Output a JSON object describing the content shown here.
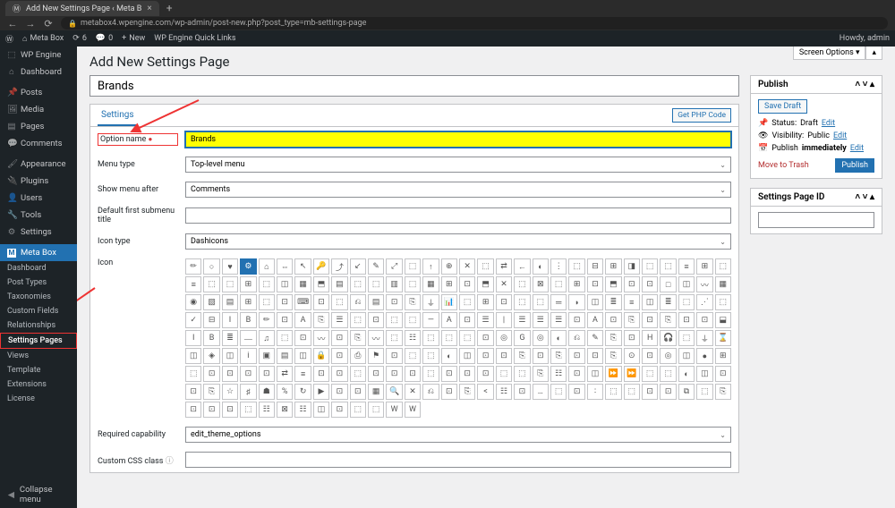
{
  "browser": {
    "tab_title": "Add New Settings Page ‹ Meta B",
    "url": "metabox4.wpengine.com/wp-admin/post-new.php?post_type=mb-settings-page"
  },
  "adminbar": {
    "site": "Meta Box",
    "updates": "6",
    "comments": "0",
    "new": "New",
    "quicklinks": "WP Engine Quick Links",
    "howdy": "Howdy, admin"
  },
  "menu": {
    "items": [
      {
        "label": "WP Engine",
        "icon": "⚙"
      },
      {
        "label": "Dashboard",
        "icon": "⌂"
      },
      {
        "label": "Posts",
        "icon": "📌"
      },
      {
        "label": "Media",
        "icon": "🖼"
      },
      {
        "label": "Pages",
        "icon": "▤"
      },
      {
        "label": "Comments",
        "icon": "💬"
      },
      {
        "label": "Appearance",
        "icon": "🖌"
      },
      {
        "label": "Plugins",
        "icon": "🔌"
      },
      {
        "label": "Users",
        "icon": "👤"
      },
      {
        "label": "Tools",
        "icon": "🔧"
      },
      {
        "label": "Settings",
        "icon": "⚙"
      }
    ],
    "metabox_label": "Meta Box",
    "submenu": [
      "Dashboard",
      "Post Types",
      "Taxonomies",
      "Custom Fields",
      "Relationships",
      "Settings Pages",
      "Views",
      "Template",
      "Extensions",
      "License"
    ],
    "collapse": "Collapse menu"
  },
  "page": {
    "heading": "Add New Settings Page",
    "title_value": "Brands",
    "screen_options": "Screen Options"
  },
  "settings": {
    "tab": "Settings",
    "get_php": "Get PHP Code",
    "fields": {
      "option_name": {
        "label": "Option name",
        "value": "Brands"
      },
      "menu_type": {
        "label": "Menu type",
        "value": "Top-level menu"
      },
      "show_menu_after": {
        "label": "Show menu after",
        "value": "Comments"
      },
      "default_submenu": {
        "label": "Default first submenu title",
        "value": ""
      },
      "icon_type": {
        "label": "Icon type",
        "value": "Dashicons"
      },
      "icon": {
        "label": "Icon"
      },
      "required_cap": {
        "label": "Required capability",
        "value": "edit_theme_options"
      },
      "css_class": {
        "label": "Custom CSS class",
        "value": ""
      }
    }
  },
  "publish": {
    "title": "Publish",
    "save_draft": "Save Draft",
    "status_label": "Status:",
    "status_value": "Draft",
    "edit": "Edit",
    "visibility_label": "Visibility:",
    "visibility_value": "Public",
    "publish_label": "Publish",
    "publish_value": "immediately",
    "trash": "Move to Trash",
    "publish_btn": "Publish"
  },
  "settings_id": {
    "title": "Settings Page ID"
  },
  "icon_glyphs": [
    "✏",
    "○",
    "♥",
    "⚙",
    "⌂",
    "⇔",
    "↖",
    "🔑",
    "⤴",
    "↙",
    "✎",
    "⤢",
    "⬚",
    "↑",
    "⊕",
    "✕",
    "⬚",
    "⇄",
    "←",
    "◐",
    "⋮",
    "⬚",
    "⊟",
    "⊞",
    "◨",
    "⬚",
    "⬚",
    "≡",
    "⊞",
    "⬚",
    "≡",
    "⬚",
    "⬚",
    "⊞",
    "⬚",
    "◫",
    "▦",
    "⬒",
    "▤",
    "⬚",
    "⬚",
    "▥",
    "⬚",
    "▦",
    "⊞",
    "⊡",
    "⬒",
    "✕",
    "⬚",
    "⊠",
    "⬚",
    "⊞",
    "⊡",
    "⬒",
    "⊡",
    "⊡",
    "□",
    "◫",
    "〰",
    "▦",
    "◉",
    "▧",
    "▤",
    "⊞",
    "⬚",
    "⊡",
    "⌨",
    "⊡",
    "⬚",
    "⎌",
    "▤",
    "⊡",
    "⎘",
    "⏚",
    "📊",
    "⬚",
    "⊞",
    "⊡",
    "⬚",
    "⬚",
    "═",
    "◗",
    "◫",
    "≣",
    "≡",
    "◫",
    "≣",
    "⬚",
    "⋰",
    "⬚",
    "✓",
    "⊟",
    "I",
    "B",
    "✏",
    "⊡",
    "A",
    "⎘",
    "☰",
    "⬚",
    "⊡",
    "⬚",
    "⬚",
    "—",
    "A",
    "⊡",
    "☰",
    "|",
    "☰",
    "☰",
    "☰",
    "⊡",
    "A",
    "⊡",
    "⎘",
    "⊡",
    "⎘",
    "⊡",
    "⊡",
    "⬓",
    "I",
    "B",
    "≣",
    "⎼",
    "♫",
    "⬚",
    "⊡",
    "〰",
    "⊡",
    "⎘",
    "〰",
    "⬚",
    "☷",
    "⬚",
    "⬚",
    "⬚",
    "⊡",
    "◎",
    "G",
    "◎",
    "◐",
    "⎌",
    "✎",
    "⎘",
    "⊡",
    "H",
    "🎧",
    "⬚",
    "⏚",
    "⌛",
    "◫",
    "◈",
    "◫",
    "i",
    "▣",
    "▤",
    "◫",
    "🔒",
    "⊡",
    "⎙",
    "⚑",
    "⊡",
    "⬚",
    "⬚",
    "◐",
    "◫",
    "⊡",
    "⊡",
    "⎘",
    "⊡",
    "⎘",
    "⊡",
    "⊡",
    "⎘",
    "⊙",
    "⊡",
    "◎",
    "◫",
    "●",
    "⊞",
    "⬚",
    "⊡",
    "⊡",
    "⊡",
    "⊡",
    "⇄",
    "≡",
    "⊡",
    "⊡",
    "⬚",
    "⊡",
    "⊡",
    "⊡",
    "⬚",
    "⊡",
    "⊡",
    "⊡",
    "⬚",
    "⬚",
    "⎘",
    "☷",
    "⊡",
    "◫",
    "⏩",
    "⏩",
    "⬚",
    "⬚",
    "◐",
    "◫",
    "⊡",
    "⊡",
    "⎘",
    "☆",
    "♯",
    "☗",
    "%",
    "↻",
    "▶",
    "⊡",
    "⊡",
    "▦",
    "🔍",
    "✕",
    "⎌",
    "⊡",
    "⎘",
    "<",
    "☷",
    "⊡",
    "…",
    "⬚",
    "⊡",
    "∶",
    "⬚",
    "⬚",
    "⊡",
    "⊡",
    "⧉",
    "⬚",
    "⎘",
    "⊡",
    "⊡",
    "⊡",
    "⬚",
    "☷",
    "⊠",
    "☷",
    "◫",
    "⊡",
    "⬚",
    "⬚",
    "W",
    "W"
  ]
}
